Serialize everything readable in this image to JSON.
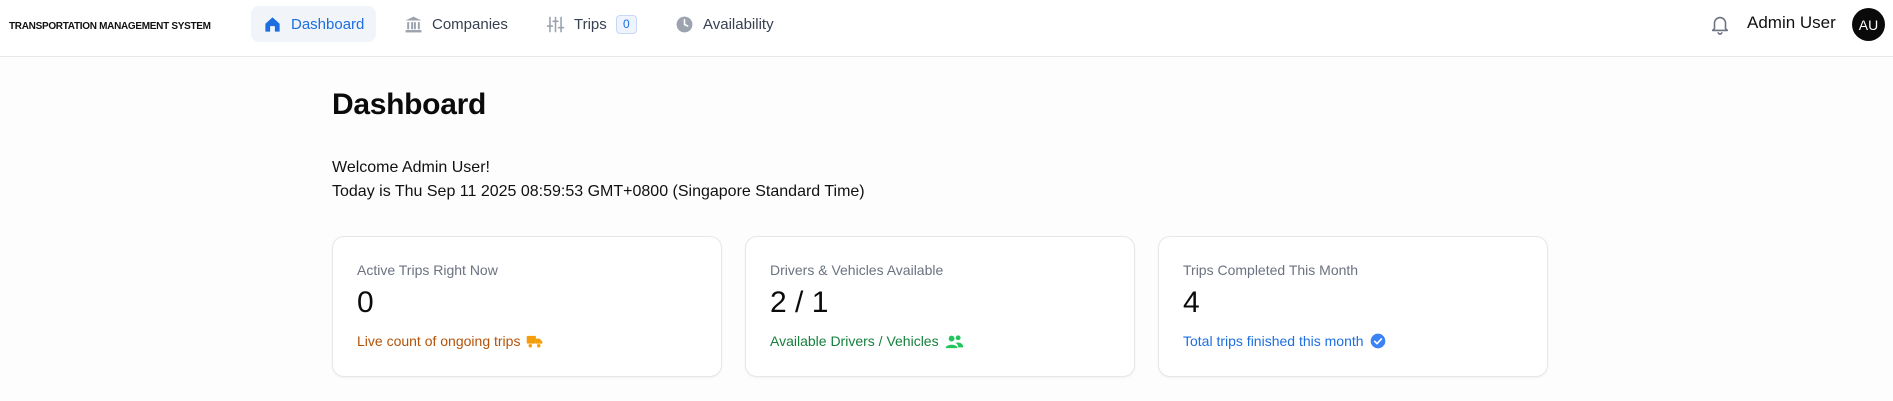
{
  "app": {
    "title": "TRANSPORTATION MANAGEMENT SYSTEM"
  },
  "nav": {
    "items": [
      {
        "label": "Dashboard",
        "icon": "home-icon",
        "active": true
      },
      {
        "label": "Companies",
        "icon": "building-icon",
        "active": false
      },
      {
        "label": "Trips",
        "icon": "sliders-icon",
        "active": false,
        "badge": "0"
      },
      {
        "label": "Availability",
        "icon": "clock-icon",
        "active": false
      }
    ]
  },
  "header": {
    "notifications_icon": "bell-icon",
    "user_name": "Admin User",
    "avatar_initials": "AU"
  },
  "main": {
    "title": "Dashboard",
    "welcome": "Welcome Admin User!",
    "today": "Today is Thu Sep 11 2025 08:59:53 GMT+0800 (Singapore Standard Time)"
  },
  "cards": [
    {
      "label": "Active Trips Right Now",
      "value": "0",
      "note": "Live count of ongoing trips",
      "icon": "truck-icon",
      "color": "#b45309"
    },
    {
      "label": "Drivers & Vehicles Available",
      "value": "2 / 1",
      "note": "Available Drivers / Vehicles",
      "icon": "users-icon",
      "color": "#15803d"
    },
    {
      "label": "Trips Completed This Month",
      "value": "4",
      "note": "Total trips finished this month",
      "icon": "check-circle-icon",
      "color": "#1d6fe0"
    }
  ],
  "colors": {
    "accent": "#1d6fe0",
    "nav_active_bg": "#f1f4f8",
    "border": "#e5e7eb"
  }
}
